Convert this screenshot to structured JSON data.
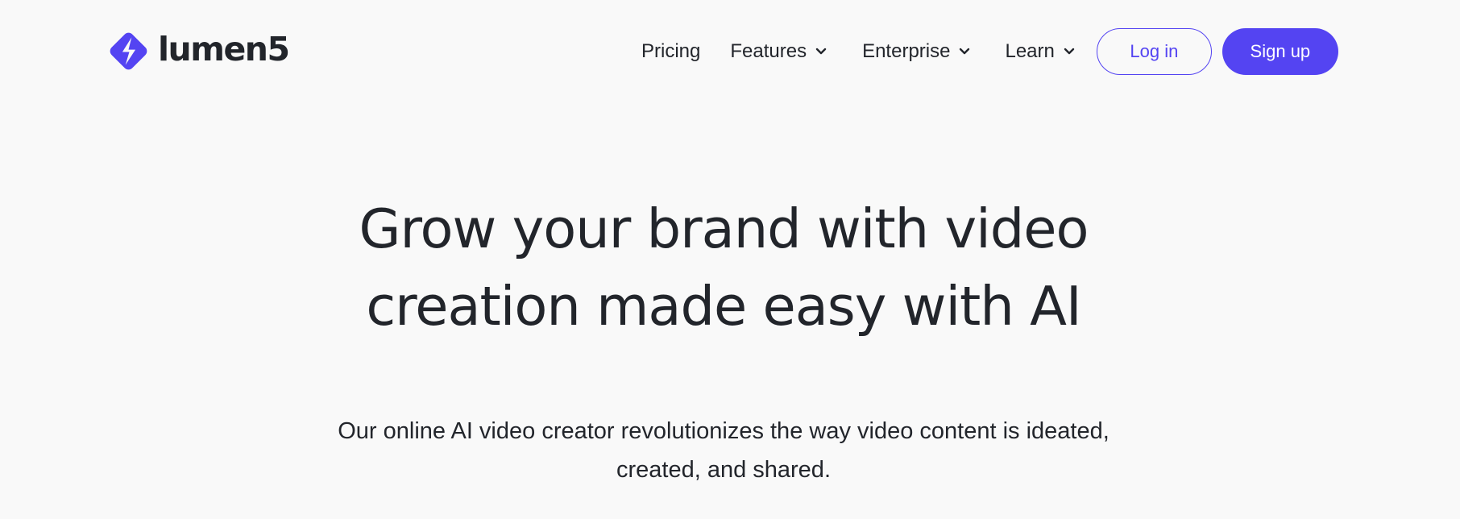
{
  "brand": {
    "name": "lumen5",
    "logo_icon": "lightning-bolt-diamond-icon",
    "accent_color": "#5444f2"
  },
  "nav": {
    "items": [
      {
        "label": "Pricing",
        "has_dropdown": false
      },
      {
        "label": "Features",
        "has_dropdown": true
      },
      {
        "label": "Enterprise",
        "has_dropdown": true
      },
      {
        "label": "Learn",
        "has_dropdown": true
      }
    ],
    "login_label": "Log in",
    "signup_label": "Sign up"
  },
  "hero": {
    "title_line1": "Grow your brand with video",
    "title_line2": "creation made easy with AI",
    "subtitle_line1": "Our online AI video creator revolutionizes the way video content is ideated,",
    "subtitle_line2": "created, and shared."
  }
}
